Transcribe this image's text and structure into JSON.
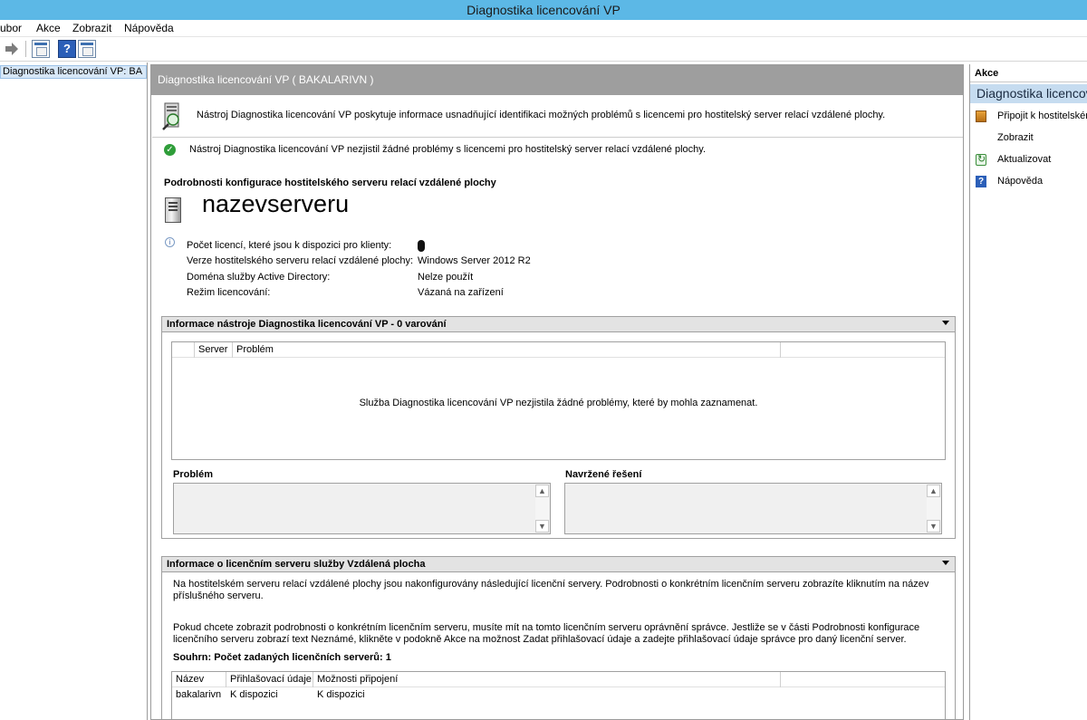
{
  "window": {
    "title": "Diagnostika licencování VP"
  },
  "menu": [
    "ubor",
    "Akce",
    "Zobrazit",
    "Nápověda"
  ],
  "tree": {
    "selected": "Diagnostika licencování VP: BA"
  },
  "center": {
    "header": "Diagnostika licencování VP ( BAKALARIVN )",
    "description": "Nástroj Diagnostika licencování VP poskytuje informace usnadňující identifikaci možných problémů s licencemi pro hostitelský server relací vzdálené plochy.",
    "status": "Nástroj Diagnostika licencování VP nezjistil žádné problémy s licencemi pro hostitelský server relací vzdálené plochy.",
    "config_title": "Podrobnosti konfigurace hostitelského serveru relací vzdálené plochy",
    "server_name": "nazevserveru",
    "details": [
      {
        "label": "Počet licencí, které jsou k dispozici pro klienty:",
        "value": ""
      },
      {
        "label": "Verze hostitelského serveru relací vzdálené plochy:",
        "value": "Windows Server 2012 R2"
      },
      {
        "label": "Doména služby Active Directory:",
        "value": "Nelze použít"
      },
      {
        "label": "Režim licencování:",
        "value": "Vázaná na zařízení"
      }
    ]
  },
  "diag_section": {
    "title": "Informace nástroje Diagnostika licencování VP - 0 varování",
    "columns": [
      "Server",
      "Problém"
    ],
    "empty_message": "Služba Diagnostika licencování VP nezjistila žádné problémy, které by mohla zaznamenat.",
    "problem_label": "Problém",
    "solution_label": "Navržené řešení"
  },
  "license_section": {
    "title": "Informace o licenčním serveru služby Vzdálená plocha",
    "para1": "Na hostitelském serveru relací vzdálené plochy jsou nakonfigurovány následující licenční servery. Podrobnosti o konkrétním licenčním serveru zobrazíte kliknutím na název příslušného serveru.",
    "para2": "Pokud chcete zobrazit podrobnosti o konkrétním licenčním serveru, musíte mít na tomto licenčním serveru oprávnění správce. Jestliže se v části Podrobnosti konfigurace licenčního serveru zobrazí text Neznámé, klikněte v podokně Akce na možnost Zadat přihlašovací údaje a zadejte přihlašovací údaje správce pro daný licenční server.",
    "summary": "Souhrn: Počet zadaných licenčních serverů: 1",
    "columns": [
      "Název",
      "Přihlašovací údaje",
      "Možnosti připojení"
    ],
    "rows": [
      [
        "bakalarivn",
        "K dispozici",
        "K dispozici"
      ]
    ]
  },
  "actions": {
    "header": "Akce",
    "group": "Diagnostika licencování VP",
    "items": [
      "Připojit k hostitelskému serveru",
      "Zobrazit",
      "Aktualizovat",
      "Nápověda"
    ]
  }
}
